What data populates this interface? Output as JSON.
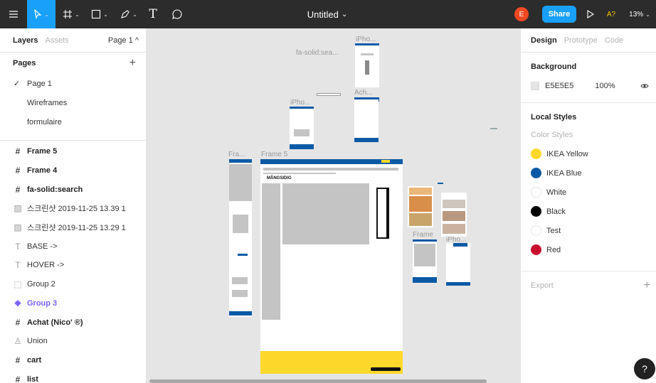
{
  "toolbar": {
    "menu_icon": "hamburger-menu-icon",
    "title": "Untitled",
    "title_caret": "⌄",
    "avatar": "E",
    "share_label": "Share",
    "a_label": "A?",
    "zoom": "13%",
    "text_tool": "T"
  },
  "left_panel": {
    "tab_layers": "Layers",
    "tab_assets": "Assets",
    "page_selector": "Page 1 ^",
    "pages_title": "Pages",
    "add": "+",
    "pages": [
      {
        "label": "Page 1",
        "check": "✓"
      },
      {
        "label": "Wireframes"
      },
      {
        "label": "formulaire"
      }
    ],
    "layers": [
      {
        "label": "Frame 5",
        "icon": "#"
      },
      {
        "label": "Frame 4",
        "icon": "#"
      },
      {
        "label": "fa-solid:search",
        "icon": "#"
      },
      {
        "label": "스크린샷 2019-11-25 13.39 1",
        "icon": "▨"
      },
      {
        "label": "스크린샷 2019-11-25 13.29 1",
        "icon": "▨"
      },
      {
        "label": "BASE ->",
        "icon": "T"
      },
      {
        "label": "HOVER ->",
        "icon": "T"
      },
      {
        "label": "Group 2",
        "icon": "⬚"
      },
      {
        "label": "Group 3",
        "icon": "❖"
      },
      {
        "label": "Achat (Nico' ®)",
        "icon": "#"
      },
      {
        "label": "Union",
        "icon": "♙"
      },
      {
        "label": "cart",
        "icon": "#"
      },
      {
        "label": "list",
        "icon": "#"
      }
    ]
  },
  "canvas": {
    "labels": {
      "iphone_top": "iPho...",
      "fa_search": "fa-solid:sea...",
      "iphone_left": "iPho...",
      "ach": "Ach...",
      "fra": "Fra...",
      "frame5": "Frame 5",
      "frame": "Frame",
      "iphone_right": "iPho..."
    },
    "frame5_heading": "MÅNGSIDIG"
  },
  "right_panel": {
    "tab_design": "Design",
    "tab_prototype": "Prototype",
    "tab_code": "Code",
    "background_title": "Background",
    "bg_hex": "E5E5E5",
    "bg_opacity": "100%",
    "local_styles_title": "Local Styles",
    "color_styles_label": "Color Styles",
    "styles": [
      {
        "name": "IKEA Yellow",
        "color": "#fdd82b"
      },
      {
        "name": "IKEA Blue",
        "color": "#0c5aa6"
      },
      {
        "name": "White",
        "color": "#ffffff"
      },
      {
        "name": "Black",
        "color": "#000000"
      },
      {
        "name": "Test",
        "color": "#ffffff"
      },
      {
        "name": "Red",
        "color": "#c8102e"
      }
    ],
    "export_label": "Export",
    "export_add": "+",
    "help": "?"
  },
  "colors": {
    "accent": "#18a0fb",
    "toolbar_bg": "#2c2c2c",
    "canvas_bg": "#e5e5e5",
    "selection": "#7b61ff"
  }
}
